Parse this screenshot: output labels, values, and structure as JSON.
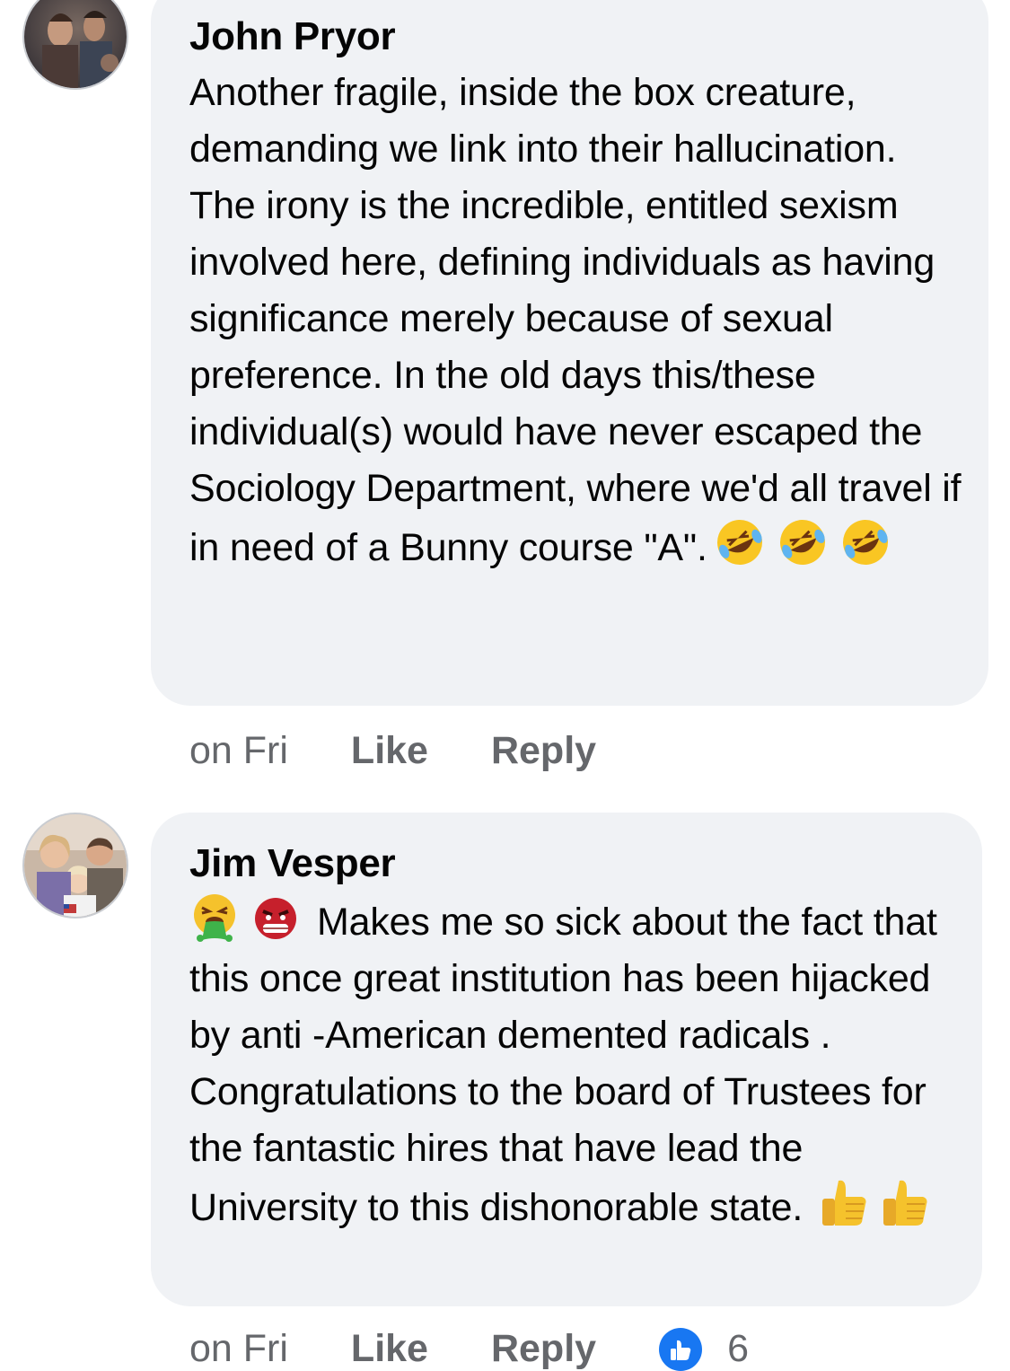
{
  "comments": [
    {
      "author": "John Pryor",
      "text": "Another fragile, inside the box creature, demanding we link into their hallucination. The irony is the incredible, entitled sexism involved here, defining individuals as having significance merely because of sexual preference. In the old days this/these individual(s) would have never escaped the Sociology Department, where we'd all travel if in need of a Bunny course \"A\".",
      "emojis": [
        "rolling-on-floor-laughing",
        "rolling-on-floor-laughing",
        "rolling-on-floor-laughing"
      ],
      "time": "on Fri",
      "like_label": "Like",
      "reply_label": "Reply"
    },
    {
      "author": "Jim Vesper",
      "lead_emojis": [
        "vomiting-face",
        "ogre"
      ],
      "text": "Makes me so sick about the fact that this once great institution has been hijacked by anti -American demented radicals . Congratulations to the board of Trustees for the fantastic hires that have lead the University to this dishonorable state.",
      "emojis": [
        "thumbs-up",
        "thumbs-up"
      ],
      "time": "on Fri",
      "like_label": "Like",
      "reply_label": "Reply",
      "reaction_icon": "like-icon",
      "reaction_count": "6"
    }
  ],
  "colors": {
    "bubble": "#f0f2f5",
    "meta": "#65676b",
    "like_blue": "#1877f2"
  }
}
